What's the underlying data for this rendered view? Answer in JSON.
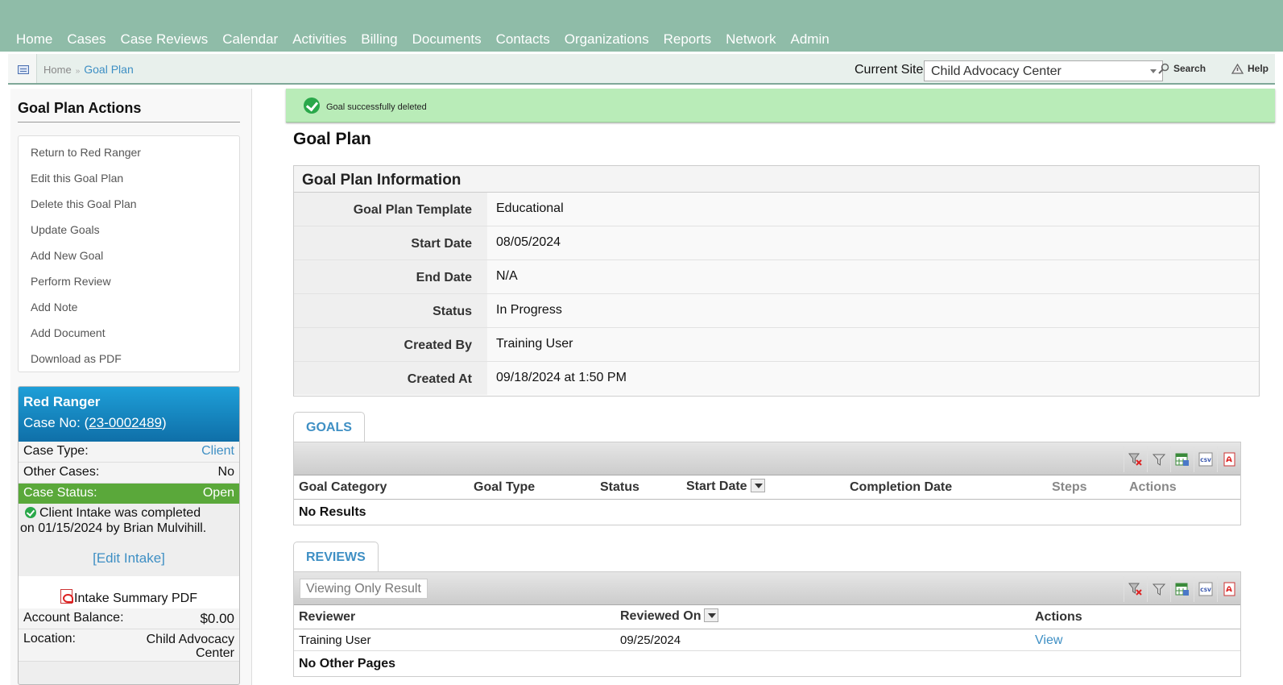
{
  "nav": [
    "Home",
    "Cases",
    "Case Reviews",
    "Calendar",
    "Activities",
    "Billing",
    "Documents",
    "Contacts",
    "Organizations",
    "Reports",
    "Network",
    "Admin"
  ],
  "breadcrumb": {
    "home": "Home",
    "separator": "»",
    "current": "Goal Plan"
  },
  "site": {
    "label": "Current Site",
    "selected": "Child Advocacy Center"
  },
  "toplinks": {
    "search": "Search",
    "help": "Help"
  },
  "sidebar": {
    "title": "Goal Plan Actions",
    "actions": [
      "Return to Red Ranger",
      "Edit this Goal Plan",
      "Delete this Goal Plan",
      "Update Goals",
      "Add New Goal",
      "Perform Review",
      "Add Note",
      "Add Document",
      "Download as PDF"
    ]
  },
  "case_card": {
    "name": "Red Ranger",
    "case_no_label": "Case No: (",
    "case_no": "23-0002489",
    "case_no_suffix": ")",
    "case_type_label": "Case Type:",
    "case_type": "Client",
    "other_cases_label": "Other Cases:",
    "other_cases": "No",
    "status_label": "Case Status:",
    "status": "Open",
    "intake_line1": "Client Intake was completed",
    "intake_line2": "on 01/15/2024 by Brian Mulvihill.",
    "edit_intake": "[Edit Intake]",
    "intake_pdf": "Intake Summary PDF",
    "balance_label": "Account Balance:",
    "balance": "$0.00",
    "location_label": "Location:",
    "location_line1": "Child Advocacy",
    "location_line2": "Center"
  },
  "flash": {
    "message": "Goal successfully deleted"
  },
  "page_title": "Goal Plan",
  "info": {
    "title": "Goal Plan Information",
    "rows": [
      {
        "label": "Goal Plan Template",
        "value": "Educational"
      },
      {
        "label": "Start Date",
        "value": "08/05/2024"
      },
      {
        "label": "End Date",
        "value": "N/A"
      },
      {
        "label": "Status",
        "value": "In Progress"
      },
      {
        "label": "Created By",
        "value": "Training User"
      },
      {
        "label": "Created At",
        "value": "09/18/2024 at 1:50 PM"
      }
    ]
  },
  "goals": {
    "tab": "GOALS",
    "columns": [
      "Goal Category",
      "Goal Type",
      "Status",
      "Start Date",
      "Completion Date",
      "Steps",
      "Actions"
    ],
    "footer": "No Results"
  },
  "reviews": {
    "tab": "REVIEWS",
    "info_button": "Viewing Only Result",
    "columns": [
      "Reviewer",
      "Reviewed On",
      "Actions"
    ],
    "rows": [
      {
        "reviewer": "Training User",
        "reviewed_on": "09/25/2024",
        "action": "View"
      }
    ],
    "footer": "No Other Pages"
  },
  "colors": {
    "nav_bg": "#8fbca8",
    "link": "#3e8fc4",
    "status_open": "#5aa83a",
    "flash_bg": "#b9ecb8",
    "case_header": "#1a8fc8"
  },
  "icons": {
    "grid_tools": [
      "clear-filter-icon",
      "filter-icon",
      "excel-export-icon",
      "csv-export-icon",
      "pdf-export-icon"
    ]
  }
}
